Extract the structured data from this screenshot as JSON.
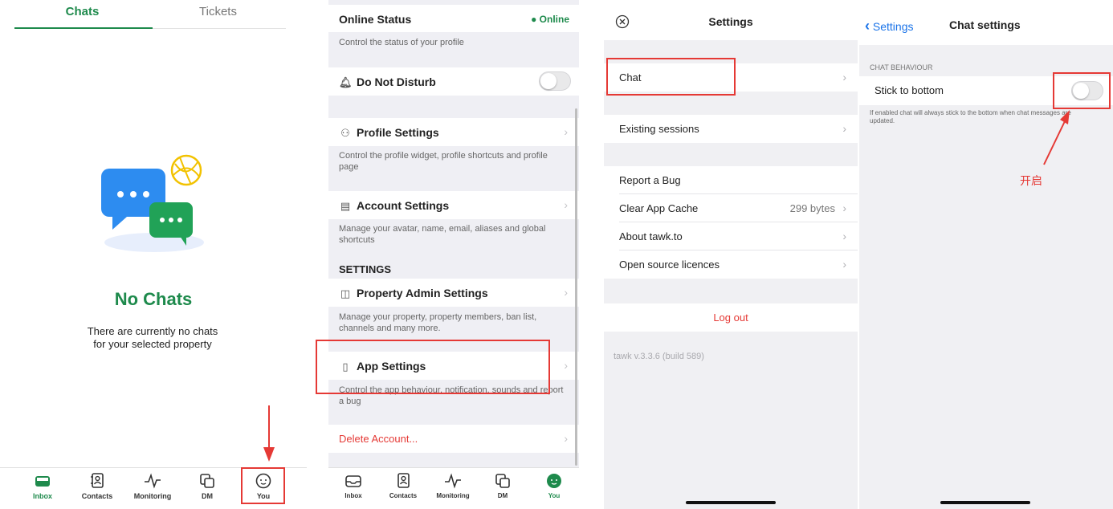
{
  "colors": {
    "green": "#1e8a4c",
    "red": "#e53935",
    "blue": "#1a73e8"
  },
  "panel1": {
    "tabs": {
      "chats": "Chats",
      "tickets": "Tickets"
    },
    "empty_title": "No Chats",
    "empty_text": "There are currently no chats for your selected property",
    "nav": {
      "inbox": "Inbox",
      "contacts": "Contacts",
      "monitoring": "Monitoring",
      "dm": "DM",
      "you": "You"
    }
  },
  "panel2": {
    "online_status": {
      "title": "Online Status",
      "value": "Online",
      "desc": "Control the status of your profile"
    },
    "dnd": {
      "title": "Do Not Disturb",
      "enabled": false
    },
    "profile": {
      "title": "Profile Settings",
      "desc": "Control the profile widget, profile shortcuts and profile page"
    },
    "account": {
      "title": "Account Settings",
      "desc": "Manage your avatar, name, email, aliases and global shortcuts"
    },
    "section": "SETTINGS",
    "property": {
      "title": "Property Admin Settings",
      "desc": "Manage your property, property members, ban list, channels and many more."
    },
    "app": {
      "title": "App Settings",
      "desc": "Control the app behaviour, notification, sounds and report a bug"
    },
    "delete": "Delete Account...",
    "nav": {
      "inbox": "Inbox",
      "contacts": "Contacts",
      "monitoring": "Monitoring",
      "dm": "DM",
      "you": "You"
    }
  },
  "panel3": {
    "title": "Settings",
    "items": {
      "chat": "Chat",
      "sessions": "Existing sessions",
      "bug": "Report a Bug",
      "cache": "Clear App Cache",
      "cache_value": "299 bytes",
      "about": "About tawk.to",
      "licences": "Open source licences"
    },
    "logout": "Log out",
    "version": "tawk v.3.3.6 (build 589)"
  },
  "panel4": {
    "back": "Settings",
    "title": "Chat settings",
    "section": "CHAT BEHAVIOUR",
    "option": "Stick to bottom",
    "option_enabled": false,
    "hint": "If enabled chat will always stick to the bottom when chat messages are updated.",
    "annotation": "开启"
  }
}
